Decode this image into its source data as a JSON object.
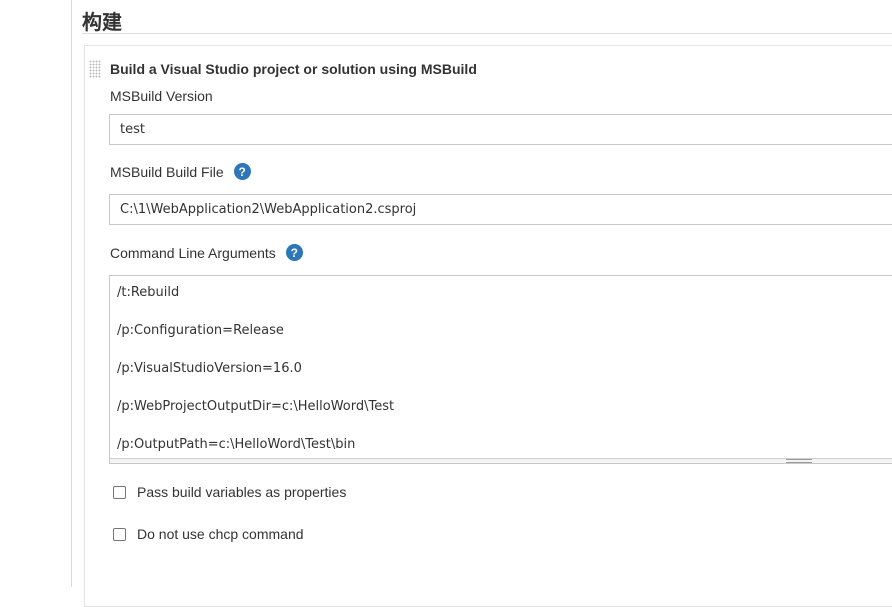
{
  "section": {
    "title": "构建"
  },
  "build_step": {
    "title": "Build a Visual Studio project or solution using MSBuild",
    "msbuild_version": {
      "label": "MSBuild Version",
      "value": "test"
    },
    "build_file": {
      "label": "MSBuild Build File",
      "value": "C:\\1\\WebApplication2\\WebApplication2.csproj",
      "help": "?"
    },
    "cmd_args": {
      "label": "Command Line Arguments",
      "help": "?",
      "lines": [
        "/t:Rebuild",
        "/p:Configuration=Release",
        "/p:VisualStudioVersion=16.0",
        "/p:WebProjectOutputDir=c:\\HelloWord\\Test",
        "/p:OutputPath=c:\\HelloWord\\Test\\bin"
      ]
    },
    "options": [
      {
        "label": "Pass build variables as properties",
        "checked": false
      },
      {
        "label": "Do not use chcp command",
        "checked": false
      }
    ]
  },
  "colors": {
    "help_icon": "#2c77b8",
    "text": "#333333",
    "border": "#c8c8c8"
  }
}
